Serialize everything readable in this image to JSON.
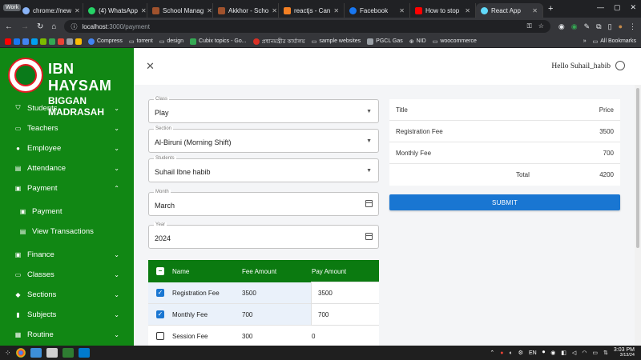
{
  "browser": {
    "workspace_badge": "Work",
    "tabs": [
      {
        "title": "chrome://new",
        "color": "#8ab4f8"
      },
      {
        "title": "(4) WhatsApp",
        "color": "#25d366"
      },
      {
        "title": "School Manag",
        "color": "#a0522d"
      },
      {
        "title": "Akkhor - Scho",
        "color": "#a0522d"
      },
      {
        "title": "reactjs - Can",
        "color": "#f48024"
      },
      {
        "title": "Facebook",
        "color": "#1877f2"
      },
      {
        "title": "How to stop",
        "color": "#ff0000"
      },
      {
        "title": "React App",
        "color": "#61dafb"
      }
    ],
    "new_tab": "+",
    "url_host": "localhost",
    "url_path": ":3000/payment",
    "bookmarks": [
      {
        "label": "Compress",
        "color": "#4285f4"
      },
      {
        "label": "torrent",
        "color": "#9aa0a6"
      },
      {
        "label": "design",
        "color": "#9aa0a6"
      },
      {
        "label": "Cubix topics - Go...",
        "color": "#34a853"
      },
      {
        "label": "প্রধানমন্ত্রীর কার্যালয়",
        "color": "#d93025"
      },
      {
        "label": "sample websites",
        "color": "#9aa0a6"
      },
      {
        "label": "PGCL Gas",
        "color": "#9aa0a6"
      },
      {
        "label": "NID",
        "color": "#9aa0a6"
      },
      {
        "label": "woocommerce",
        "color": "#9aa0a6"
      }
    ],
    "more_bookmarks": "»",
    "all_bookmarks": "All Bookmarks"
  },
  "sidebar": {
    "brand_line1": "IBN HAYSAM",
    "brand_line2": "BIGGAN MADRASAH",
    "items": [
      {
        "label": "Students",
        "icon": "graduation-cap-icon",
        "glyph": "⛉",
        "chevron": "⌄"
      },
      {
        "label": "Teachers",
        "icon": "teacher-icon",
        "glyph": "▭",
        "chevron": "⌄"
      },
      {
        "label": "Employee",
        "icon": "person-icon",
        "glyph": "●",
        "chevron": "⌄"
      },
      {
        "label": "Attendance",
        "icon": "attendance-icon",
        "glyph": "▤",
        "chevron": "⌄"
      },
      {
        "label": "Payment",
        "icon": "payment-icon",
        "glyph": "▣",
        "chevron": "⌃"
      },
      {
        "label": "Payment",
        "icon": "payment-sub-icon",
        "glyph": "▣",
        "chevron": ""
      },
      {
        "label": "View Transactions",
        "icon": "transactions-icon",
        "glyph": "▤",
        "chevron": ""
      },
      {
        "label": "Finance",
        "icon": "finance-icon",
        "glyph": "▣",
        "chevron": "⌄"
      },
      {
        "label": "Classes",
        "icon": "classes-icon",
        "glyph": "▭",
        "chevron": "⌄"
      },
      {
        "label": "Sections",
        "icon": "sections-icon",
        "glyph": "◆",
        "chevron": "⌄"
      },
      {
        "label": "Subjects",
        "icon": "subjects-icon",
        "glyph": "▮",
        "chevron": "⌄"
      },
      {
        "label": "Routine",
        "icon": "routine-icon",
        "glyph": "▦",
        "chevron": "⌄"
      }
    ]
  },
  "header": {
    "close": "✕",
    "greeting": "Hello Suhail_habib"
  },
  "form": {
    "class_label": "Class",
    "class_value": "Play",
    "section_label": "Section",
    "section_value": "Al-Biruni (Morning Shift)",
    "student_label": "Students",
    "student_value": "Suhail Ibne habib",
    "month_label": "Month",
    "month_value": "March",
    "year_label": "Year",
    "year_value": "2024",
    "dropdown_glyph": "▼"
  },
  "fee_table": {
    "headers": [
      "Name",
      "Fee Amount",
      "Pay Amount"
    ],
    "rows": [
      {
        "name": "Registration Fee",
        "fee": "3500",
        "pay": "3500",
        "checked": true
      },
      {
        "name": "Monthly Fee",
        "fee": "700",
        "pay": "700",
        "checked": true
      },
      {
        "name": "Session Fee",
        "fee": "300",
        "pay": "0",
        "checked": false
      }
    ]
  },
  "summary": {
    "title_header": "Title",
    "price_header": "Price",
    "rows": [
      {
        "title": "Registration Fee",
        "price": "3500"
      },
      {
        "title": "Monthly Fee",
        "price": "700"
      }
    ],
    "total_label": "Total",
    "total_value": "4200",
    "submit_label": "SUBMIT"
  },
  "taskbar": {
    "time": "3:03 PM",
    "date": "3/13/24",
    "lang": "EN"
  },
  "colors": {
    "sidebar_green": "#118714",
    "table_header_green": "#0b7a10",
    "primary_blue": "#1976d2"
  }
}
